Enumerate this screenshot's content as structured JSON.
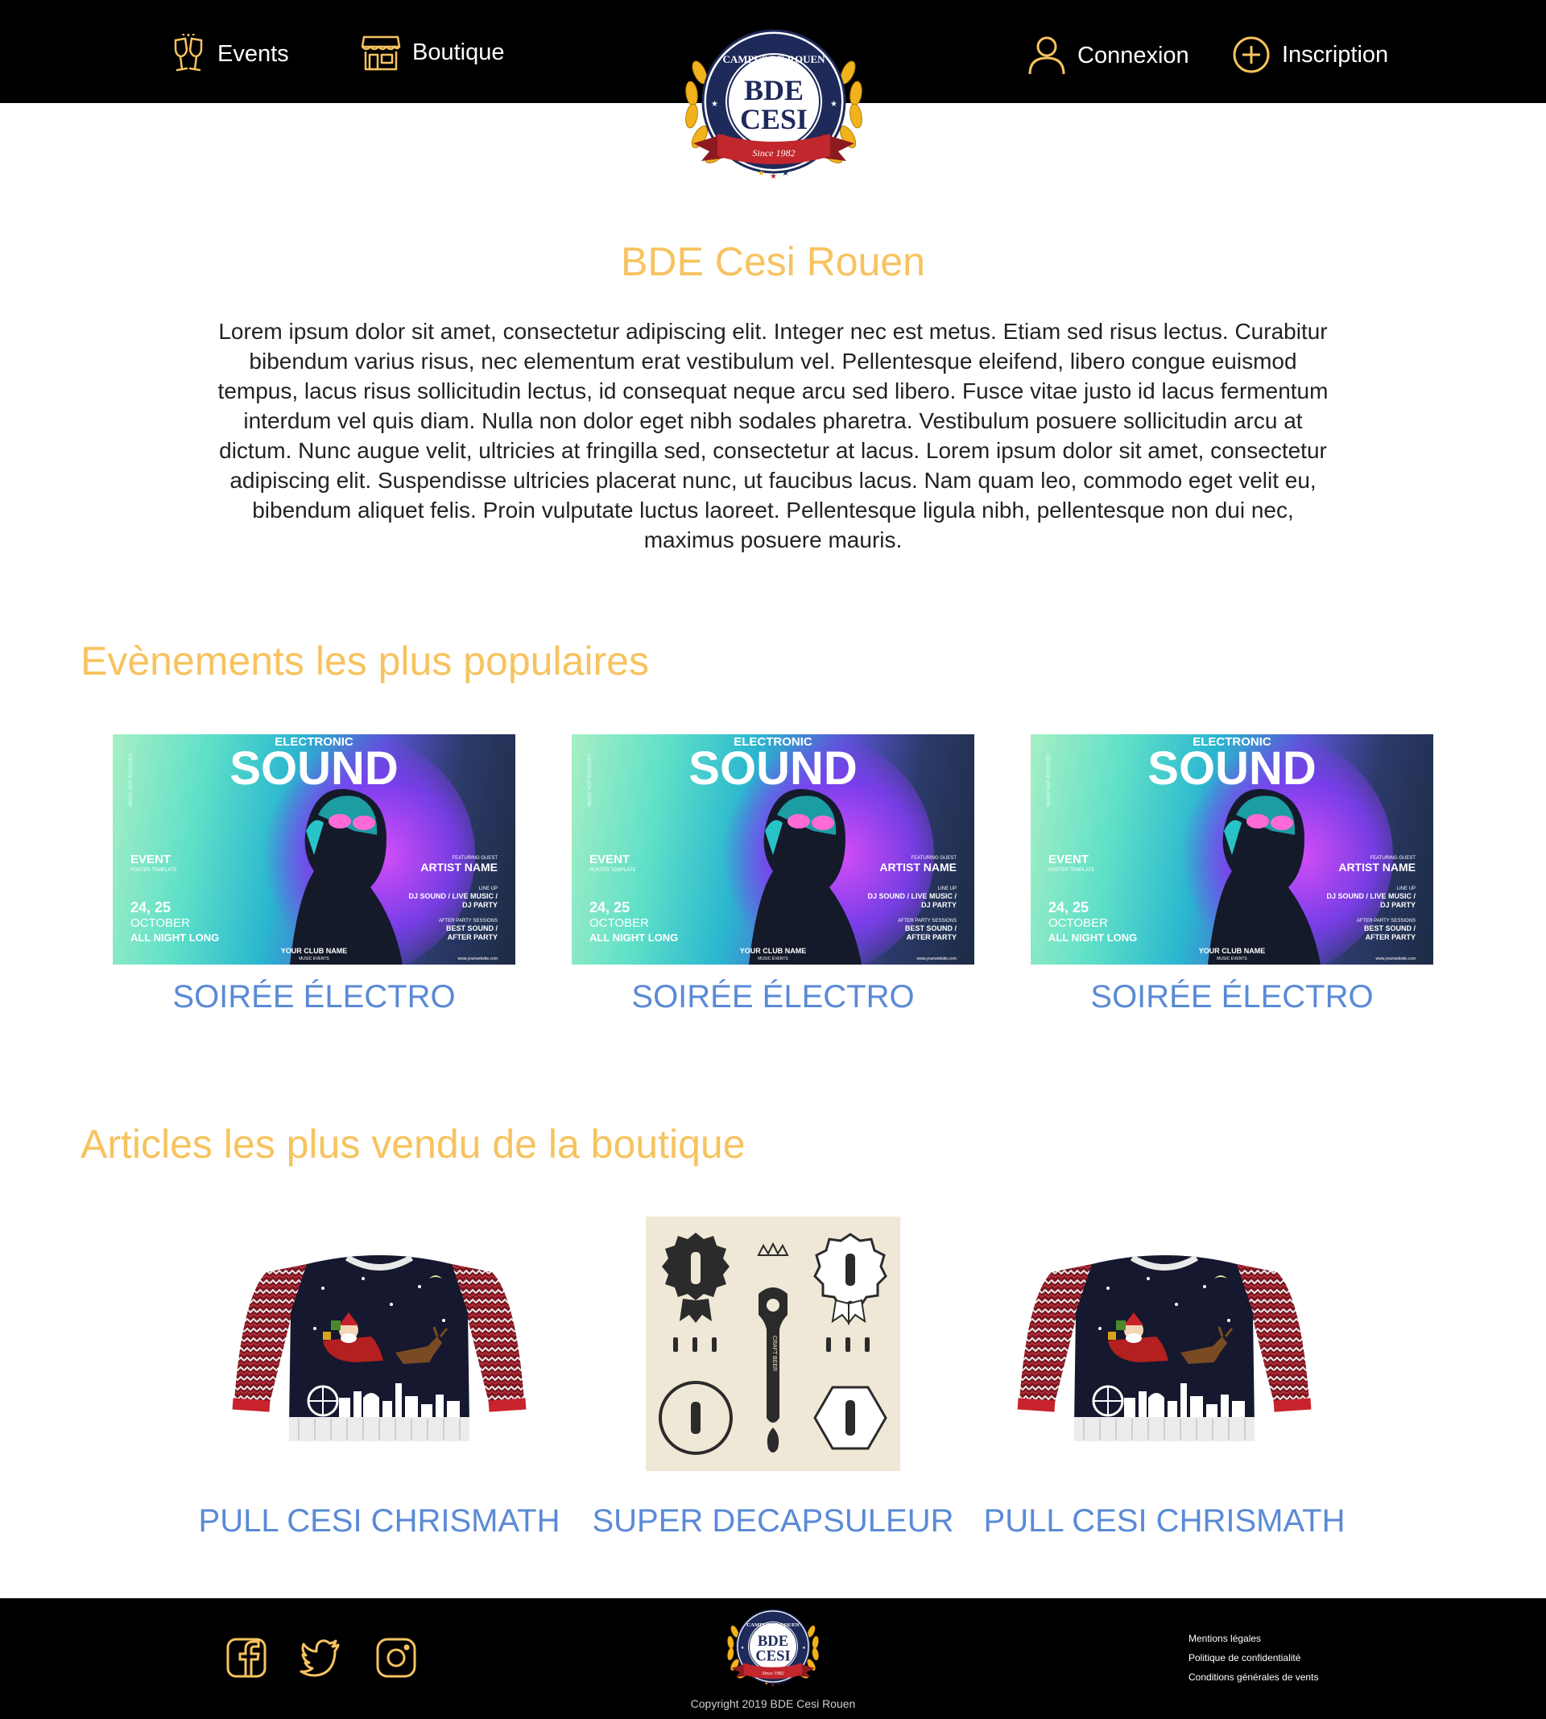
{
  "header": {
    "nav_left": [
      {
        "label": "Events",
        "icon": "champagne-glasses-icon"
      },
      {
        "label": "Boutique",
        "icon": "store-icon"
      }
    ],
    "nav_right": [
      {
        "label": "Connexion",
        "icon": "user-icon"
      },
      {
        "label": "Inscription",
        "icon": "plus-circle-icon"
      }
    ],
    "logo": {
      "ring_text": "CAMPUS DE ROUEN",
      "line1": "BDE",
      "line2": "CESI",
      "ribbon": "Since 1982"
    }
  },
  "intro": {
    "title": "BDE Cesi Rouen",
    "text": "Lorem ipsum dolor sit amet, consectetur adipiscing elit. Integer nec est metus. Etiam sed risus lectus. Curabitur bibendum varius risus, nec elementum erat vestibulum vel. Pellentesque eleifend, libero congue euismod tempus, lacus risus sollicitudin lectus, id consequat neque arcu sed libero. Fusce vitae justo id lacus fermentum interdum vel quis diam. Nulla non dolor eget nibh sodales pharetra. Vestibulum posuere sollicitudin arcu at dictum. Nunc augue velit, ultricies at fringilla sed, consectetur at lacus. Lorem ipsum dolor sit amet, consectetur adipiscing elit. Suspendisse ultricies placerat nunc, ut faucibus lacus. Nam quam leo, commodo eget velit eu, bibendum aliquet felis. Proin vulputate luctus laoreet. Pellentesque ligula nibh, pellentesque non dui nec, maximus posuere mauris."
  },
  "events": {
    "title": "Evènements les plus populaires",
    "poster": {
      "kicker": "ELECTRONIC",
      "headline": "SOUND",
      "side_note": "IMAGE NOT INCLUDED",
      "event_label": "EVENT",
      "event_sub": "POSTER TEMPLATE",
      "date": "24, 25",
      "month": "OCTOBER",
      "night": "ALL NIGHT LONG",
      "featuring": "FEATURING GUEST",
      "artist": "ARTIST NAME",
      "lineup_label": "LINE UP",
      "lineup": "DJ SOUND / LIVE MUSIC /",
      "lineup2": "DJ PARTY",
      "after_label": "AFTER PARTY SESSIONS",
      "after1": "BEST SOUND /",
      "after2": "AFTER PARTY",
      "club": "YOUR CLUB NAME",
      "club_sub": "MUSIC EVENTS",
      "website": "www.yourwebsite.com"
    },
    "items": [
      {
        "label": "SOIRÉE ÉLECTRO"
      },
      {
        "label": "SOIRÉE ÉLECTRO"
      },
      {
        "label": "SOIRÉE ÉLECTRO"
      }
    ]
  },
  "shop": {
    "title": "Articles les plus vendu de la boutique",
    "items": [
      {
        "label": "PULL CESI CHRISMATH",
        "image": "christmas-sweater"
      },
      {
        "label": "SUPER DECAPSULEUR",
        "image": "bottle-opener-set",
        "opener_text": "CRAFT BEER"
      },
      {
        "label": "PULL CESI CHRISMATH",
        "image": "christmas-sweater"
      }
    ]
  },
  "footer": {
    "social": [
      "facebook-icon",
      "twitter-icon",
      "instagram-icon"
    ],
    "links": [
      "Mentions légales",
      "Politique de confidentialité",
      "Conditions générales de vents"
    ],
    "copyright": "Copyright 2019 BDE Cesi Rouen"
  },
  "colors": {
    "accent_gold": "#f7c35f",
    "link_blue": "#5a8ad6",
    "header_bg": "#000000",
    "logo_navy": "#1e2a5a",
    "logo_red": "#c1272d"
  }
}
